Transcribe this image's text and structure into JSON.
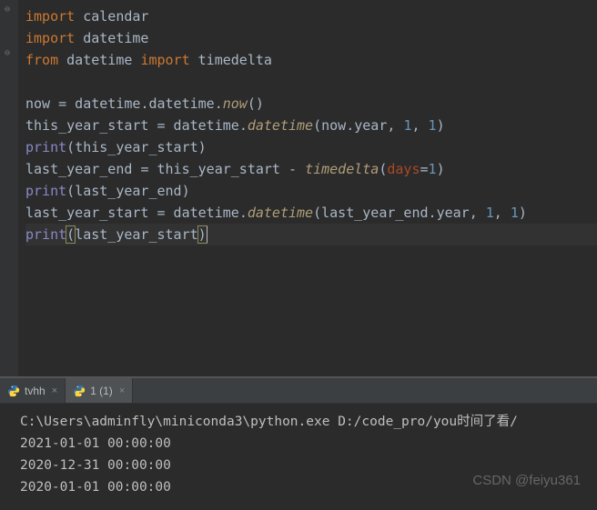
{
  "code": {
    "lines": [
      {
        "tokens": [
          [
            "kw",
            "import"
          ],
          [
            "id",
            " calendar"
          ]
        ]
      },
      {
        "tokens": [
          [
            "kw",
            "import"
          ],
          [
            "id",
            " datetime"
          ]
        ]
      },
      {
        "tokens": [
          [
            "kw",
            "from"
          ],
          [
            "id",
            " datetime "
          ],
          [
            "kw",
            "import"
          ],
          [
            "id",
            " timedelta"
          ]
        ]
      },
      {
        "tokens": []
      },
      {
        "tokens": [
          [
            "id",
            "now "
          ],
          [
            "op",
            "="
          ],
          [
            "id",
            " datetime"
          ],
          [
            "op",
            "."
          ],
          [
            "id",
            "datetime"
          ],
          [
            "op",
            "."
          ],
          [
            "fn",
            "now"
          ],
          [
            "op",
            "()"
          ]
        ]
      },
      {
        "tokens": [
          [
            "id",
            "this_year_start "
          ],
          [
            "op",
            "="
          ],
          [
            "id",
            " datetime"
          ],
          [
            "op",
            "."
          ],
          [
            "fn",
            "datetime"
          ],
          [
            "op",
            "("
          ],
          [
            "id",
            "now"
          ],
          [
            "op",
            "."
          ],
          [
            "id",
            "year"
          ],
          [
            "op",
            ", "
          ],
          [
            "num",
            "1"
          ],
          [
            "op",
            ", "
          ],
          [
            "num",
            "1"
          ],
          [
            "op",
            ")"
          ]
        ]
      },
      {
        "tokens": [
          [
            "builtin",
            "print"
          ],
          [
            "op",
            "("
          ],
          [
            "id",
            "this_year_start"
          ],
          [
            "op",
            ")"
          ]
        ]
      },
      {
        "tokens": [
          [
            "id",
            "last_year_end "
          ],
          [
            "op",
            "="
          ],
          [
            "id",
            " this_year_start "
          ],
          [
            "op",
            "-"
          ],
          [
            "id",
            " "
          ],
          [
            "fn",
            "timedelta"
          ],
          [
            "op",
            "("
          ],
          [
            "param",
            "days"
          ],
          [
            "op",
            "="
          ],
          [
            "num",
            "1"
          ],
          [
            "op",
            ")"
          ]
        ]
      },
      {
        "tokens": [
          [
            "builtin",
            "print"
          ],
          [
            "op",
            "("
          ],
          [
            "id",
            "last_year_end"
          ],
          [
            "op",
            ")"
          ]
        ]
      },
      {
        "tokens": [
          [
            "id",
            "last_year_start "
          ],
          [
            "op",
            "="
          ],
          [
            "id",
            " datetime"
          ],
          [
            "op",
            "."
          ],
          [
            "fn",
            "datetime"
          ],
          [
            "op",
            "("
          ],
          [
            "id",
            "last_year_end"
          ],
          [
            "op",
            "."
          ],
          [
            "id",
            "year"
          ],
          [
            "op",
            ", "
          ],
          [
            "num",
            "1"
          ],
          [
            "op",
            ", "
          ],
          [
            "num",
            "1"
          ],
          [
            "op",
            ")"
          ]
        ]
      },
      {
        "tokens": [
          [
            "builtin",
            "print"
          ],
          [
            "hlop",
            "("
          ],
          [
            "id",
            "last_year_start"
          ],
          [
            "hlop",
            ")"
          ]
        ],
        "current": true,
        "cursor_after": true
      }
    ]
  },
  "tabs": [
    {
      "label": "tvhh",
      "active": false
    },
    {
      "label": "1 (1)",
      "active": true
    }
  ],
  "console": {
    "lines": [
      "C:\\Users\\adminfly\\miniconda3\\python.exe D:/code_pro/you时间了看/",
      "2021-01-01 00:00:00",
      "2020-12-31 00:00:00",
      "2020-01-01 00:00:00"
    ]
  },
  "watermark": "CSDN @feiyu361"
}
